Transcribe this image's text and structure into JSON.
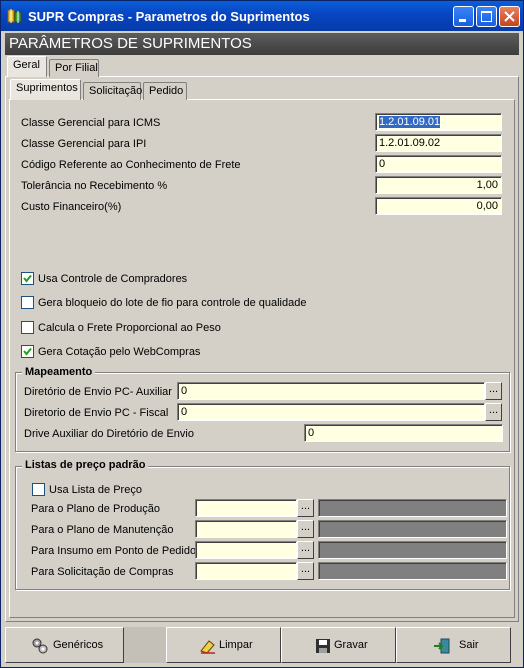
{
  "window": {
    "title": "SUPR Compras - Parametros do Suprimentos"
  },
  "banner": {
    "text": "PARÂMETROS DE SUPRIMENTOS"
  },
  "outer_tabs": [
    {
      "label": "Geral"
    },
    {
      "label": "Por Filial"
    }
  ],
  "inner_tabs": [
    {
      "label": "Suprimentos"
    },
    {
      "label": "Solicitação"
    },
    {
      "label": "Pedido"
    }
  ],
  "fields": [
    {
      "label": "Classe Gerencial para ICMS",
      "value": "1.2.01.09.01"
    },
    {
      "label": "Classe Gerencial para IPI",
      "value": "1.2.01.09.02"
    },
    {
      "label": "Código Referente ao Conhecimento de Frete",
      "value": "0"
    },
    {
      "label": "Tolerância no Recebimento %",
      "value": "1,00"
    },
    {
      "label": "Custo Financeiro(%)",
      "value": "0,00"
    }
  ],
  "checkboxes": [
    {
      "label": "Usa Controle de Compradores",
      "checked": true
    },
    {
      "label": "Gera bloqueio do lote de fio para controle de qualidade",
      "checked": false
    },
    {
      "label": "Calcula o Frete Proporcional ao Peso",
      "checked": false
    },
    {
      "label": "Gera Cotação pelo WebCompras",
      "checked": true
    }
  ],
  "mapeamento": {
    "title": "Mapeamento",
    "rows": [
      {
        "label": "Diretório de Envio PC- Auxiliar",
        "value": "0"
      },
      {
        "label": "Diretorio de Envio PC - Fiscal",
        "value": "0"
      },
      {
        "label": "Drive Auxiliar do Diretório de Envio",
        "value": "0"
      }
    ]
  },
  "listas": {
    "title": "Listas de preço padrão",
    "checkbox": {
      "label": "Usa Lista de Preço",
      "checked": false
    },
    "rows": [
      {
        "label": "Para o Plano de Produção",
        "value": ""
      },
      {
        "label": "Para o Plano de Manutenção",
        "value": ""
      },
      {
        "label": "Para Insumo em Ponto de Pedido",
        "value": ""
      },
      {
        "label": "Para Solicitação de Compras",
        "value": ""
      }
    ]
  },
  "ellipsis": "...",
  "buttons": {
    "genericos": "Genéricos",
    "limpar": "Limpar",
    "gravar": "Gravar",
    "sair": "Sair"
  },
  "colors": {
    "title_bar": "#0a5fd8",
    "banner": "#4a4a4a",
    "field_bg": "#ffffe1",
    "face": "#d4d0c8",
    "selection": "#316ac5"
  }
}
